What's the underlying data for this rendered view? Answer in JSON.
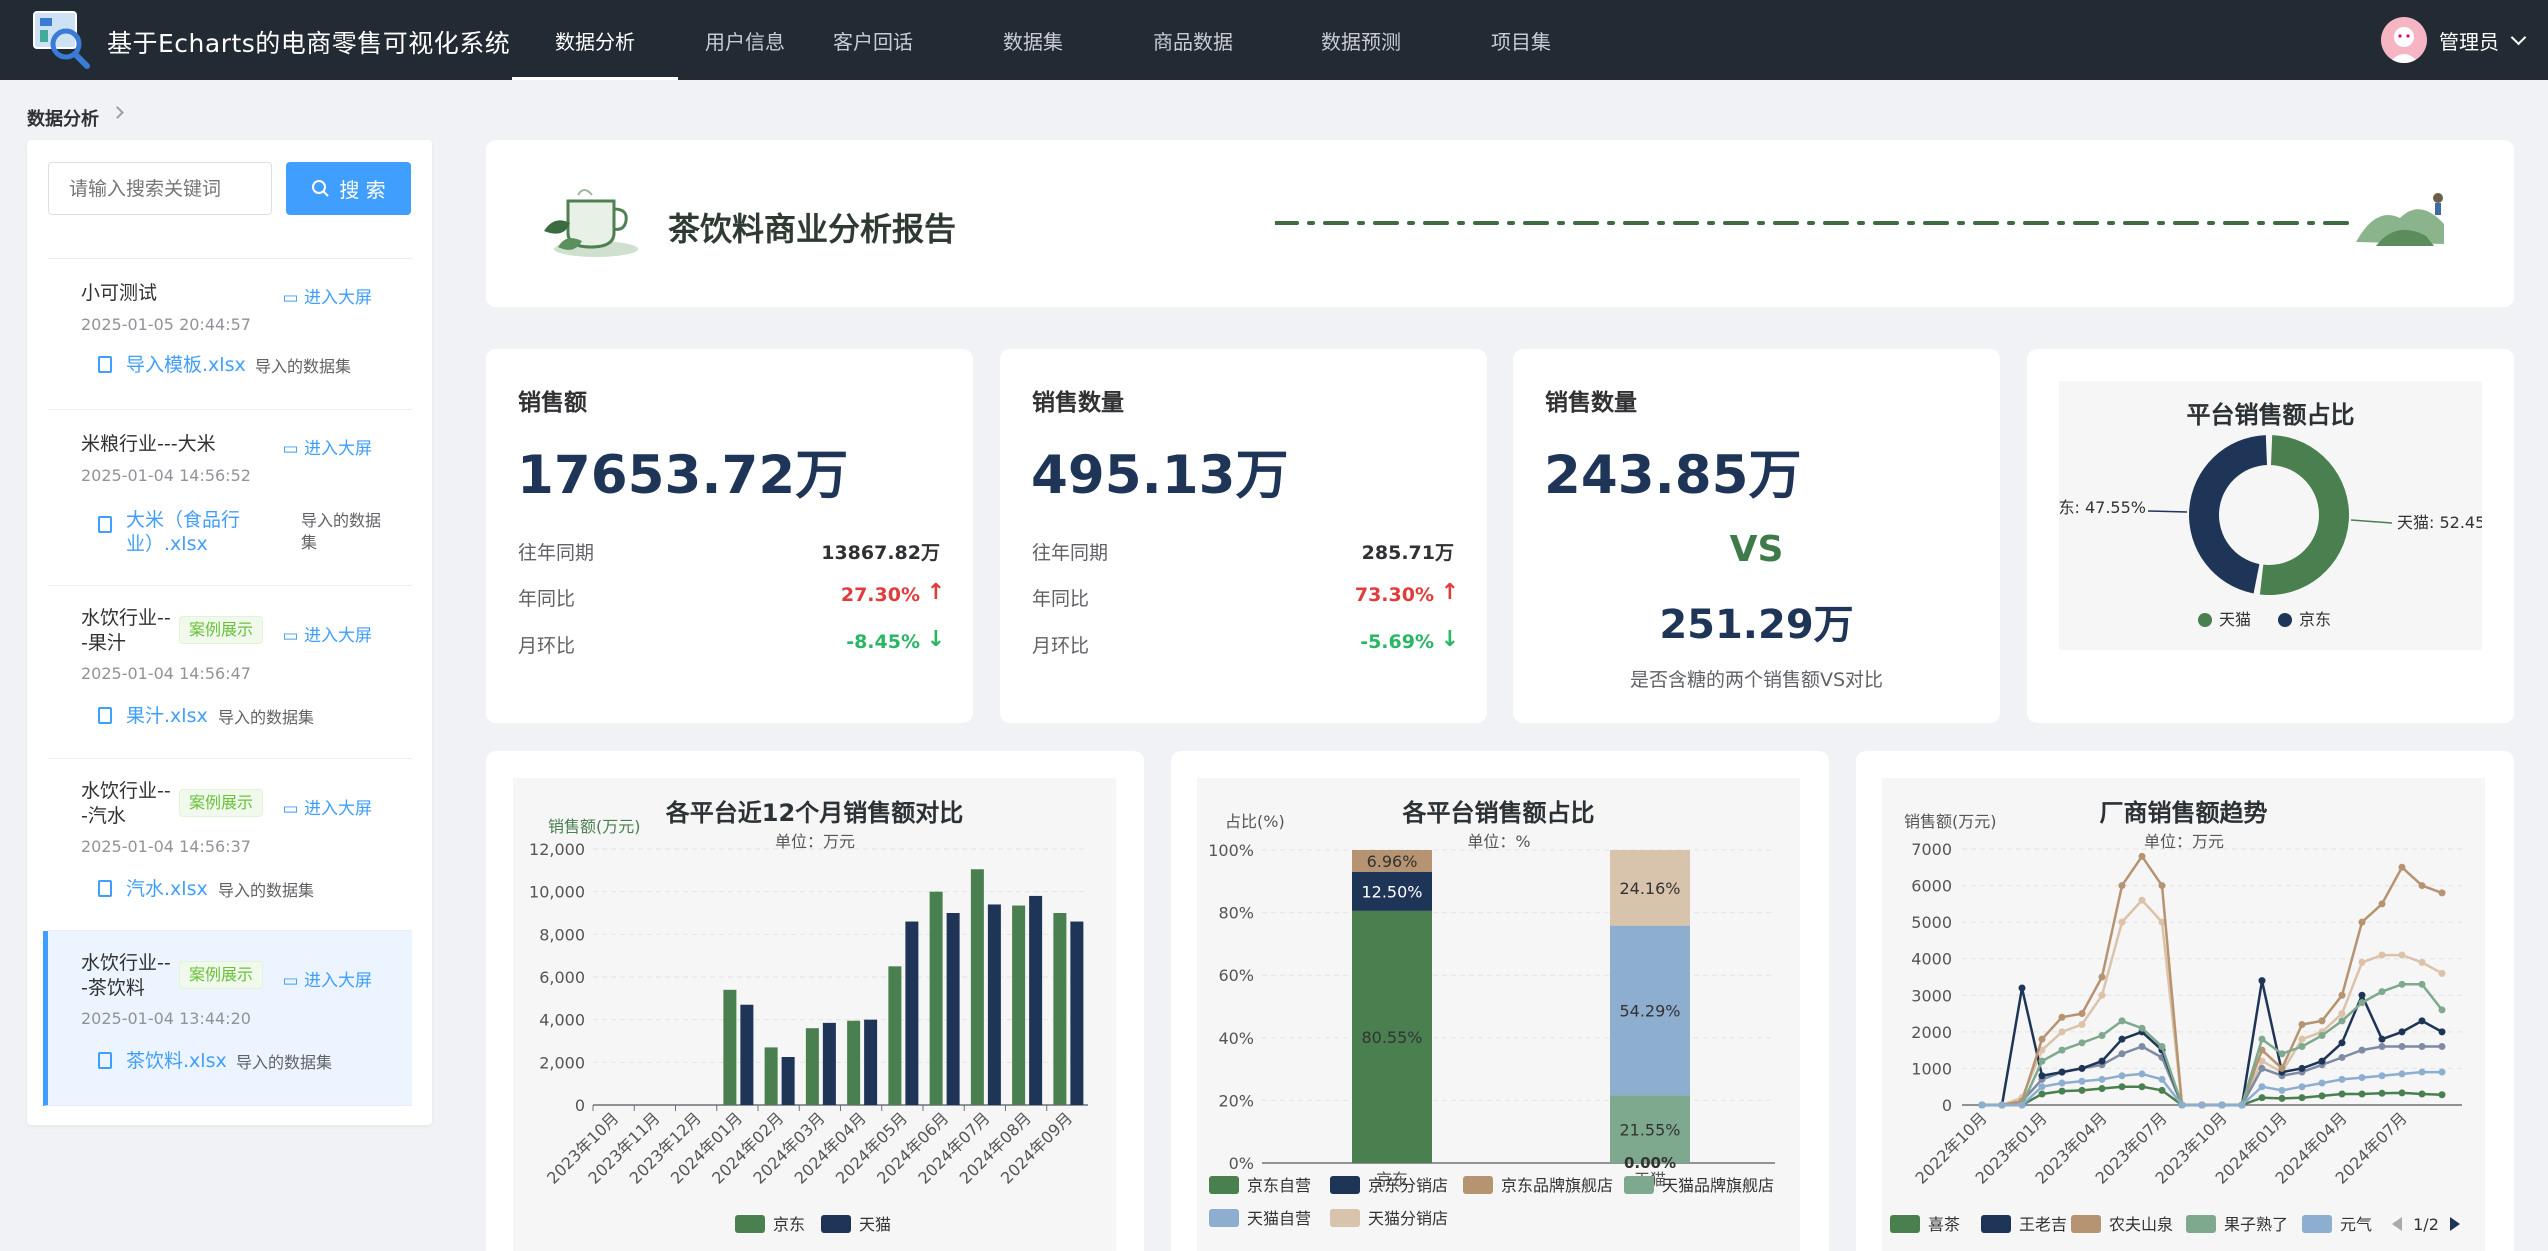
{
  "app": {
    "title": "基于Echarts的电商零售可视化系统"
  },
  "nav": [
    {
      "label": "数据分析",
      "active": true
    },
    {
      "label": "用户信息"
    },
    {
      "label": "客户回话"
    },
    {
      "label": "数据集"
    },
    {
      "label": "商品数据"
    },
    {
      "label": "数据预测"
    },
    {
      "label": "项目集"
    }
  ],
  "user": {
    "name": "管理员"
  },
  "breadcrumb": "数据分析",
  "search": {
    "placeholder": "请输入搜索关键词",
    "button": "搜 索"
  },
  "datasets": [
    {
      "name": "小可测试",
      "tag": "",
      "enter": "进入大屏",
      "time": "2025-01-05 20:44:57",
      "file": "导入模板.xlsx",
      "source": "导入的数据集"
    },
    {
      "name": "米粮行业---大米",
      "tag": "",
      "enter": "进入大屏",
      "time": "2025-01-04 14:56:52",
      "file": "大米（食品行业）.xlsx",
      "source": "导入的数据集"
    },
    {
      "name": "水饮行业---果汁",
      "tag": "案例展示",
      "enter": "进入大屏",
      "time": "2025-01-04 14:56:47",
      "file": "果汁.xlsx",
      "source": "导入的数据集"
    },
    {
      "name": "水饮行业---汽水",
      "tag": "案例展示",
      "enter": "进入大屏",
      "time": "2025-01-04 14:56:37",
      "file": "汽水.xlsx",
      "source": "导入的数据集"
    },
    {
      "name": "水饮行业---茶饮料",
      "tag": "案例展示",
      "enter": "进入大屏",
      "time": "2025-01-04 13:44:20",
      "file": "茶饮料.xlsx",
      "source": "导入的数据集",
      "selected": true
    }
  ],
  "report": {
    "title": "茶饮料商业分析报告"
  },
  "stats": {
    "sales": {
      "label": "销售额",
      "value": "17653.72万",
      "prev_label": "往年同期",
      "prev": "13867.82万",
      "yoy_label": "年同比",
      "yoy": "27.30%",
      "mom_label": "月环比",
      "mom": "-8.45%"
    },
    "qty": {
      "label": "销售数量",
      "value": "495.13万",
      "prev_label": "往年同期",
      "prev": "285.71万",
      "yoy_label": "年同比",
      "yoy": "73.30%",
      "mom_label": "月环比",
      "mom": "-5.69%"
    },
    "vs": {
      "label": "销售数量",
      "value1": "243.85万",
      "vs": "VS",
      "value2": "251.29万",
      "caption": "是否含糖的两个销售额VS对比"
    }
  },
  "colors": {
    "green": "#4a7f50",
    "navy": "#1e3557",
    "up": "#e03c3c",
    "down": "#29b765",
    "brand": "#409eff"
  },
  "chart_data": [
    {
      "type": "pie",
      "title": "平台销售额占比",
      "slices": [
        {
          "name": "天猫",
          "value": 52.45
        },
        {
          "name": "京东",
          "value": 47.55
        }
      ],
      "labels": [
        "天猫: 52.45",
        "东: 47.55%"
      ],
      "legend": [
        "天猫",
        "京东"
      ]
    },
    {
      "type": "bar",
      "title": "各平台近12个月销售额对比",
      "subtitle": "单位：万元",
      "ylabel": "销售额(万元)",
      "ylim": [
        0,
        12000
      ],
      "yticks": [
        "0",
        "2,000",
        "4,000",
        "6,000",
        "8,000",
        "10,000",
        "12,000"
      ],
      "categories": [
        "2023年10月",
        "2023年11月",
        "2023年12月",
        "2024年01月",
        "2024年02月",
        "2024年03月",
        "2024年04月",
        "2024年05月",
        "2024年06月",
        "2024年07月",
        "2024年08月",
        "2024年09月"
      ],
      "series": [
        {
          "name": "京东",
          "values": [
            0,
            0,
            0,
            5400,
            2700,
            3600,
            3950,
            6500,
            10000,
            11050,
            9350,
            9000
          ]
        },
        {
          "name": "天猫",
          "values": [
            0,
            0,
            0,
            4700,
            2250,
            3850,
            4000,
            8600,
            9000,
            9400,
            9800,
            8600
          ]
        }
      ]
    },
    {
      "type": "bar",
      "title": "各平台销售额占比",
      "subtitle": "单位：%",
      "ylabel": "占比(%)",
      "ylim": [
        0,
        100
      ],
      "yticks": [
        "0%",
        "20%",
        "40%",
        "60%",
        "80%",
        "100%"
      ],
      "categories": [
        "京东",
        "天猫"
      ],
      "series": [
        {
          "name": "京东自营",
          "values": [
            80.55,
            0
          ]
        },
        {
          "name": "京东分销店",
          "values": [
            12.5,
            0
          ]
        },
        {
          "name": "京东品牌旗舰店",
          "values": [
            6.96,
            0
          ]
        },
        {
          "name": "天猫品牌旗舰店",
          "values": [
            0,
            21.55
          ]
        },
        {
          "name": "天猫自营",
          "values": [
            0,
            54.29
          ]
        },
        {
          "name": "天猫分销店",
          "values": [
            0,
            24.16
          ]
        }
      ],
      "labels": [
        "80.55%",
        "12.50%",
        "6.96%",
        "21.55%",
        "54.29%",
        "24.16%",
        "0.00%"
      ]
    },
    {
      "type": "line",
      "title": "厂商销售额趋势",
      "subtitle": "单位：万元",
      "ylabel": "销售额(万元)",
      "ylim": [
        0,
        7000
      ],
      "yticks": [
        "0",
        "1000",
        "2000",
        "3000",
        "4000",
        "5000",
        "6000",
        "7000"
      ],
      "xticks": [
        "2022年10月",
        "2023年01月",
        "2023年04月",
        "2023年07月",
        "2023年10月",
        "2024年01月",
        "2024年04月",
        "2024年07月"
      ],
      "series": [
        {
          "name": "喜茶",
          "values": [
            0,
            0,
            0,
            300,
            380,
            400,
            450,
            500,
            500,
            400,
            0,
            0,
            0,
            0,
            200,
            180,
            200,
            250,
            300,
            300,
            320,
            330,
            300,
            280
          ]
        },
        {
          "name": "王老吉",
          "values": [
            0,
            0,
            3200,
            800,
            900,
            1000,
            1200,
            1800,
            2000,
            1500,
            0,
            0,
            0,
            0,
            3400,
            900,
            1000,
            1200,
            1700,
            3000,
            1800,
            2000,
            2300,
            2000
          ]
        },
        {
          "name": "农夫山泉",
          "values": [
            0,
            0,
            100,
            1800,
            2400,
            2500,
            3500,
            6000,
            6800,
            6000,
            0,
            0,
            0,
            0,
            1500,
            1000,
            2200,
            2300,
            3000,
            5000,
            5500,
            6500,
            6000,
            5800
          ]
        },
        {
          "name": "果子熟了",
          "values": [
            0,
            0,
            0,
            1200,
            1500,
            1700,
            1900,
            2300,
            2100,
            1600,
            0,
            0,
            0,
            0,
            1800,
            1400,
            1600,
            1900,
            2300,
            2800,
            3100,
            3300,
            3300,
            2600
          ]
        },
        {
          "name": "元气",
          "values": [
            0,
            0,
            0,
            500,
            600,
            650,
            700,
            800,
            850,
            700,
            0,
            0,
            0,
            0,
            500,
            400,
            500,
            600,
            700,
            750,
            800,
            850,
            900,
            900
          ]
        }
      ],
      "extra_series": [
        {
          "values": [
            0,
            0,
            200,
            1500,
            2000,
            2200,
            3000,
            5000,
            5600,
            5000,
            0,
            0,
            0,
            0,
            1200,
            900,
            1800,
            2000,
            2500,
            3900,
            4100,
            4100,
            3900,
            3600
          ]
        },
        {
          "values": [
            0,
            0,
            100,
            700,
            900,
            1000,
            1100,
            1400,
            1600,
            1300,
            0,
            0,
            0,
            0,
            1000,
            800,
            900,
            1100,
            1300,
            1500,
            1600,
            1600,
            1600,
            1600
          ]
        }
      ],
      "legend": [
        "喜茶",
        "王老吉",
        "农夫山泉",
        "果子熟了",
        "元气"
      ],
      "page": "1/2"
    }
  ]
}
